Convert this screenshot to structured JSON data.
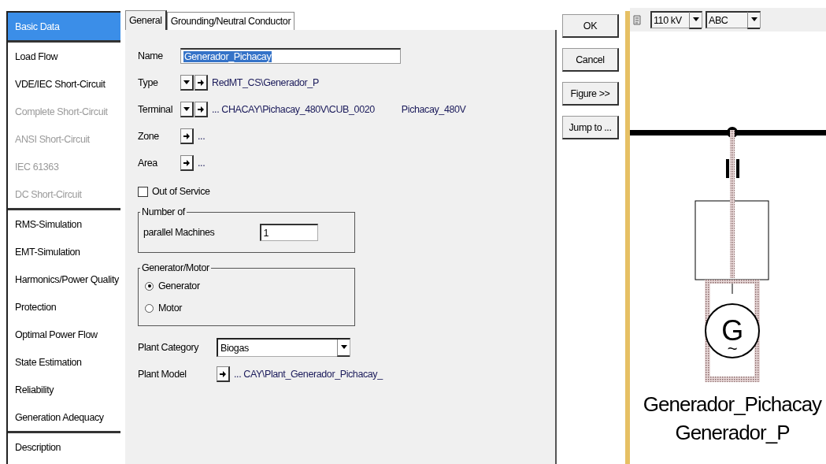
{
  "sidebar": {
    "groups": [
      {
        "items": [
          {
            "label": "Basic Data",
            "selected": true,
            "disabled": false
          }
        ]
      },
      {
        "items": [
          {
            "label": "Load Flow",
            "selected": false,
            "disabled": false
          },
          {
            "label": "VDE/IEC Short-Circuit",
            "selected": false,
            "disabled": false
          },
          {
            "label": "Complete Short-Circuit",
            "selected": false,
            "disabled": true
          },
          {
            "label": "ANSI Short-Circuit",
            "selected": false,
            "disabled": true
          },
          {
            "label": "IEC 61363",
            "selected": false,
            "disabled": true
          },
          {
            "label": "DC Short-Circuit",
            "selected": false,
            "disabled": true
          }
        ]
      },
      {
        "items": [
          {
            "label": "RMS-Simulation",
            "selected": false,
            "disabled": false
          },
          {
            "label": "EMT-Simulation",
            "selected": false,
            "disabled": false
          },
          {
            "label": "Harmonics/Power Quality",
            "selected": false,
            "disabled": false
          },
          {
            "label": "Protection",
            "selected": false,
            "disabled": false
          },
          {
            "label": "Optimal Power Flow",
            "selected": false,
            "disabled": false
          },
          {
            "label": "State Estimation",
            "selected": false,
            "disabled": false
          },
          {
            "label": "Reliability",
            "selected": false,
            "disabled": false
          },
          {
            "label": "Generation Adequacy",
            "selected": false,
            "disabled": false
          }
        ]
      },
      {
        "items": [
          {
            "label": "Description",
            "selected": false,
            "disabled": false
          }
        ]
      }
    ]
  },
  "tabs": [
    {
      "label": "General",
      "selected": true
    },
    {
      "label": "Grounding/Neutral Conductor",
      "selected": false
    }
  ],
  "form": {
    "rows": [
      {
        "kind": "input",
        "label": "Name",
        "value": "Generador_Pichacay",
        "highlighted": true
      },
      {
        "kind": "pick",
        "label": "Type",
        "value": "RedMT_CS\\Generador_P"
      },
      {
        "kind": "pick",
        "label": "Terminal",
        "value": "... CHACAY\\Pichacay_480V\\CUB_0020",
        "extra": "Pichacay_480V"
      },
      {
        "kind": "link",
        "label": "Zone",
        "value": "..."
      },
      {
        "kind": "link",
        "label": "Area",
        "value": "..."
      }
    ],
    "out_of_service": {
      "label": "Out of Service",
      "checked": false
    },
    "number_group": {
      "legend": "Number of",
      "label": "parallel Machines",
      "value": "1"
    },
    "mode_group": {
      "legend": "Generator/Motor",
      "options": [
        {
          "label": "Generator",
          "selected": true
        },
        {
          "label": "Motor",
          "selected": false
        }
      ]
    },
    "plant_category": {
      "label": "Plant Category",
      "value": "Biogas"
    },
    "plant_model": {
      "label": "Plant Model",
      "value": "... CAY\\Plant_Generador_Pichacay_"
    }
  },
  "buttons": [
    "OK",
    "Cancel",
    "Figure >>",
    "Jump to ..."
  ],
  "diagram": {
    "voltage": "110 kV",
    "phases": "ABC",
    "generator_symbol": "G",
    "ac_symbol": "~",
    "labels": [
      "Generador_Pichacay",
      "Generador_P"
    ]
  }
}
